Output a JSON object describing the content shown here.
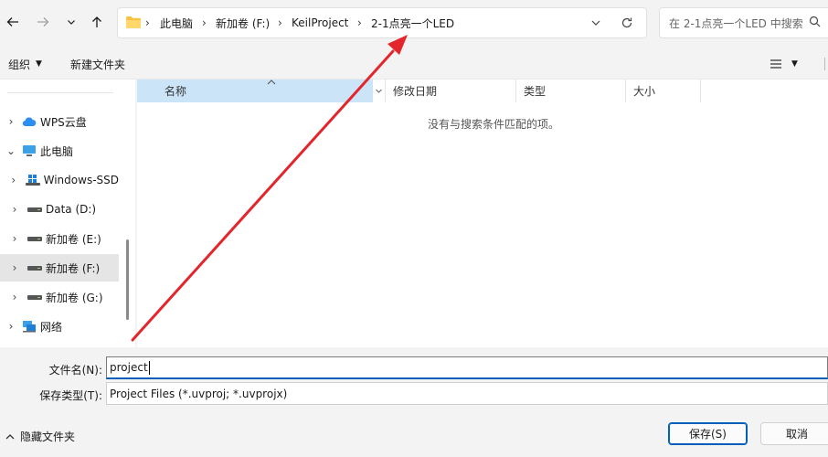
{
  "address_bar": {
    "crumbs": [
      "此电脑",
      "新加卷 (F:)",
      "KeilProject",
      "2-1点亮一个LED"
    ]
  },
  "search": {
    "placeholder": "在 2-1点亮一个LED 中搜索"
  },
  "toolbar": {
    "organize": "组织",
    "new_folder": "新建文件夹"
  },
  "nav_pane": {
    "items": [
      {
        "label": "WPS云盘",
        "icon": "cloud-icon"
      },
      {
        "label": "此电脑",
        "icon": "computer-icon"
      },
      {
        "label": "Windows-SSD",
        "icon": "windows-drive-icon"
      },
      {
        "label": "Data (D:)",
        "icon": "drive-icon"
      },
      {
        "label": "新加卷 (E:)",
        "icon": "drive-icon"
      },
      {
        "label": "新加卷 (F:)",
        "icon": "drive-icon"
      },
      {
        "label": "新加卷 (G:)",
        "icon": "drive-icon"
      },
      {
        "label": "网络",
        "icon": "network-icon"
      }
    ]
  },
  "file_list": {
    "columns": [
      "名称",
      "修改日期",
      "类型",
      "大小"
    ],
    "empty_message": "没有与搜索条件匹配的项。"
  },
  "form": {
    "filename_label": "文件名(N):",
    "filename_value": "project",
    "filetype_label": "保存类型(T):",
    "filetype_value": "Project Files (*.uvproj; *.uvprojx)"
  },
  "footer": {
    "hide_folders": "隐藏文件夹",
    "save_button": "保存(S)",
    "cancel_button": "取消"
  },
  "colors": {
    "accent": "#005fb8",
    "selected_header": "#cce4f7",
    "annotation_arrow": "#e3262c",
    "folder": "#f6c342"
  }
}
